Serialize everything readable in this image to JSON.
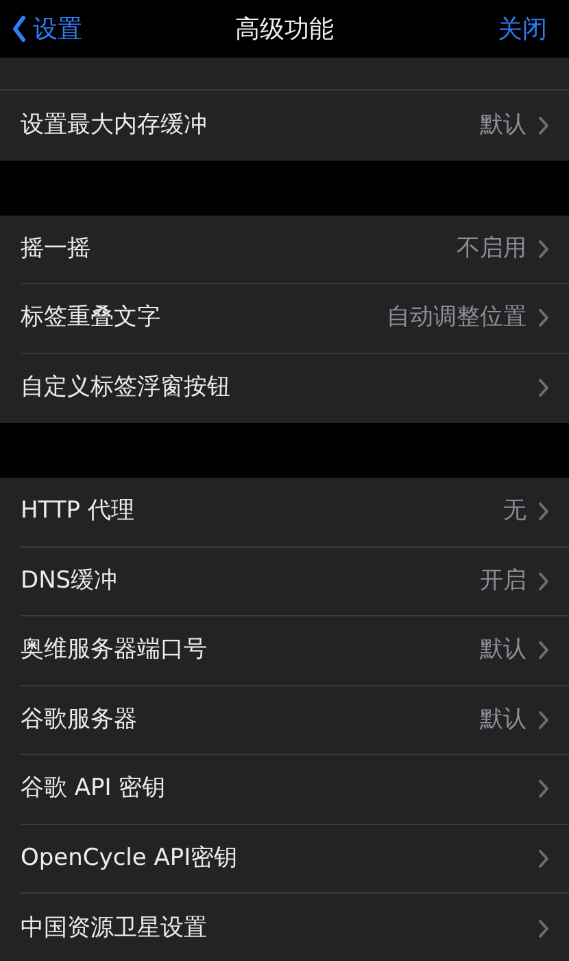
{
  "nav": {
    "back_label": "设置",
    "title": "高级功能",
    "close_label": "关闭"
  },
  "groups": [
    {
      "rows": [
        {
          "label": "设置最大内存缓冲",
          "value": "默认"
        }
      ]
    },
    {
      "rows": [
        {
          "label": "摇一摇",
          "value": "不启用"
        },
        {
          "label": "标签重叠文字",
          "value": "自动调整位置"
        },
        {
          "label": "自定义标签浮窗按钮"
        }
      ]
    },
    {
      "rows": [
        {
          "label": "HTTP 代理",
          "value": "无"
        },
        {
          "label": "DNS缓冲",
          "value": "开启"
        },
        {
          "label": "奥维服务器端口号",
          "value": "默认"
        },
        {
          "label": "谷歌服务器",
          "value": "默认"
        },
        {
          "label": "谷歌 API 密钥"
        },
        {
          "label": "OpenCycle API密钥"
        },
        {
          "label": "中国资源卫星设置"
        }
      ]
    }
  ]
}
